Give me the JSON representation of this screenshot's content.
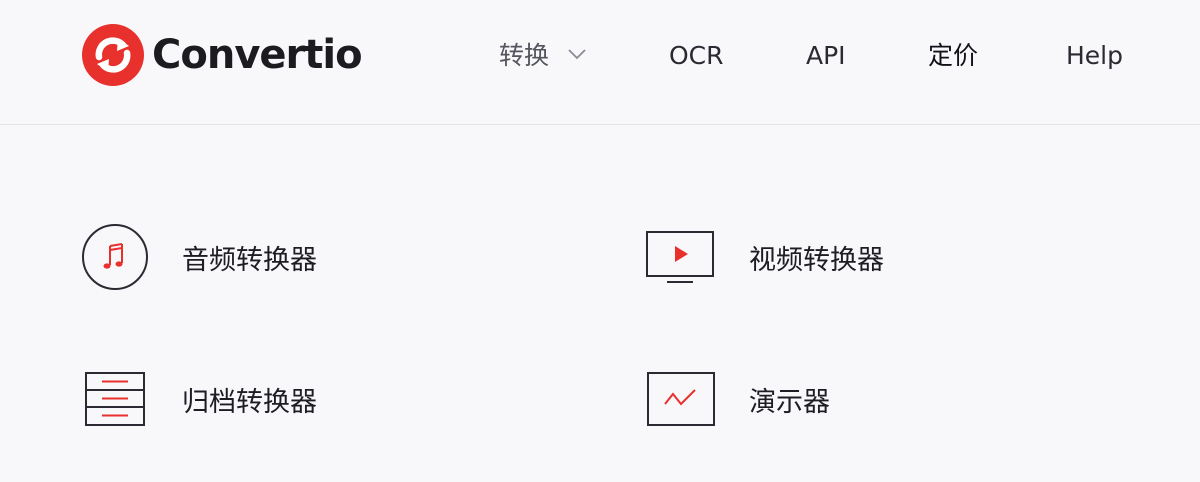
{
  "header": {
    "brand": "Convertio",
    "logo_icon": "convertio-logo-icon",
    "brand_color": "#e8302c",
    "nav": {
      "convert": "转换",
      "ocr": "OCR",
      "api": "API",
      "pricing": "定价",
      "help": "Help"
    }
  },
  "menu": {
    "items": [
      {
        "label": "音频转换器",
        "icon": "music-note-icon"
      },
      {
        "label": "视频转换器",
        "icon": "video-play-icon"
      },
      {
        "label": "归档转换器",
        "icon": "archive-box-icon"
      },
      {
        "label": "演示器",
        "icon": "presentation-icon"
      }
    ]
  }
}
